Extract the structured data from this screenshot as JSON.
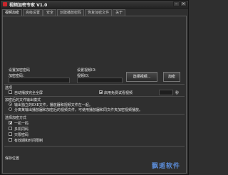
{
  "window": {
    "title": "视频加密专家 V1.0",
    "buttons": {
      "minimize": "–",
      "close": "×"
    }
  },
  "tabs": [
    "视频加密",
    "高级设置",
    "安全",
    "创建播放密码",
    "恢复加密文件",
    "关于"
  ],
  "encrypt": {
    "password_group_label": "设置加密密码",
    "password_label": "加密密码：",
    "password_value": "",
    "video_id_group_label": "设置视频ID：",
    "video_id_label": "视频ID：",
    "video_id_value": "",
    "select_video_button": "选择视频...",
    "encrypt_button": "加密"
  },
  "options": {
    "section_title": "选项",
    "auto_fullscreen_label": "自动播放完全全屏",
    "auto_fullscreen_checked": false,
    "free_trial_label": "启用免费试看视频",
    "free_trial_checked": true,
    "free_trial_seconds": "",
    "seconds_unit": "秒"
  },
  "output_mode": {
    "section_title": "加密后的文件输出模式",
    "option1": "输出独立的EXE文件，播放器和视频文件在一起。",
    "option1_selected": true,
    "option2": "分离某输出播放器和加密后的视频文件，可使用播放器和同文件夹加密视频播放。",
    "option2_selected": false
  },
  "encrypt_kind": {
    "section_title": "选择加密方式",
    "items": [
      "一机一码",
      "多机同码",
      "只限密码",
      "有效期和时间限制"
    ],
    "checked": [
      true,
      false,
      false,
      false
    ]
  },
  "save_location": {
    "label": "保存位置"
  },
  "watermark": "飘遥软件"
}
